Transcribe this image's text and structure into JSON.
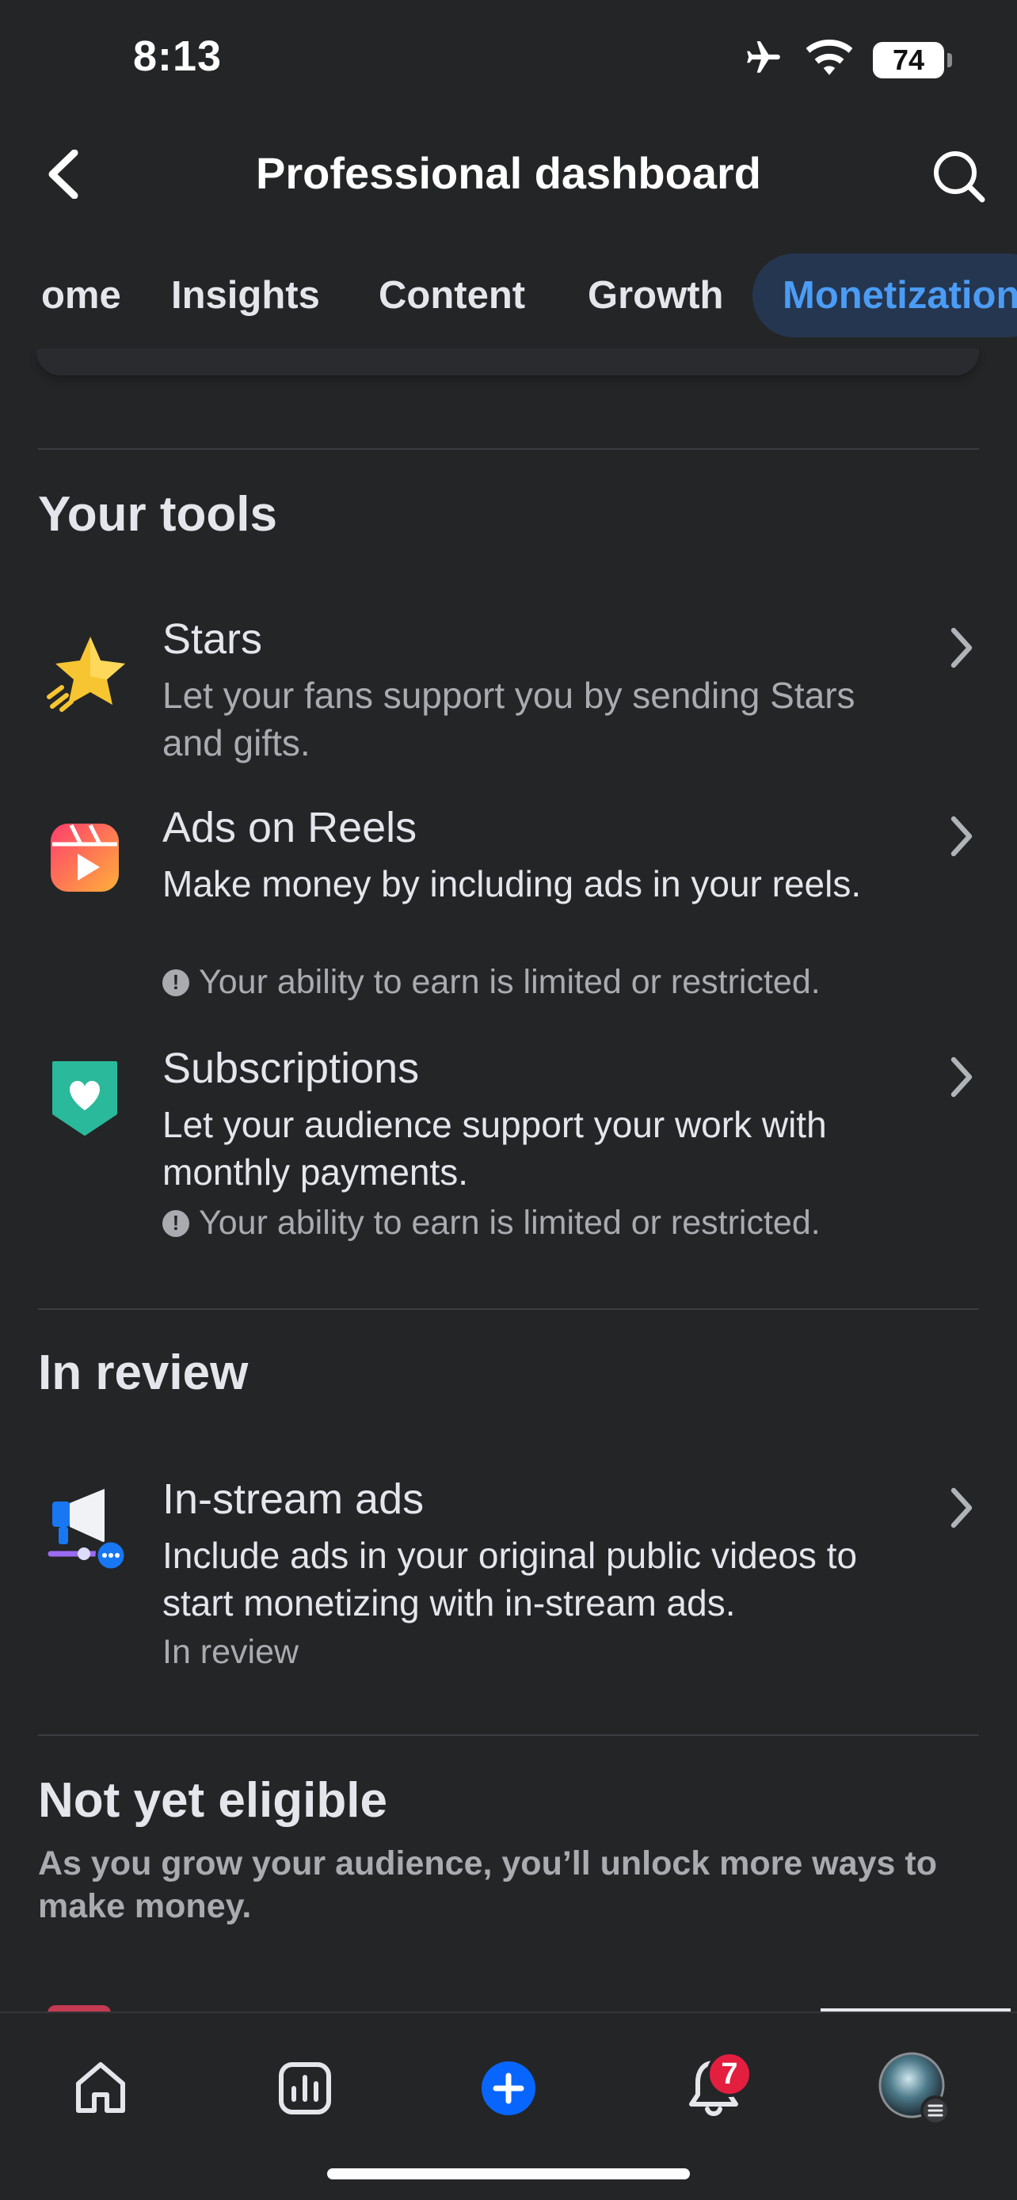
{
  "status_bar": {
    "time": "8:13",
    "battery": "74"
  },
  "header": {
    "title": "Professional dashboard"
  },
  "tabs": [
    {
      "label": "ome"
    },
    {
      "label": "Insights"
    },
    {
      "label": "Content"
    },
    {
      "label": "Growth"
    },
    {
      "label": "Monetization",
      "active": true
    }
  ],
  "your_tools": {
    "title": "Your tools",
    "items": [
      {
        "title": "Stars",
        "description": "Let your fans support you by sending Stars and gifts.",
        "icon": "star-icon"
      },
      {
        "title": "Ads on Reels",
        "description": "Make money by including ads in your reels.",
        "note": "Your ability to earn is limited or restricted.",
        "icon": "reels-icon"
      },
      {
        "title": "Subscriptions",
        "description": "Let your audience support your work with monthly payments.",
        "note": "Your ability to earn is limited or restricted.",
        "icon": "heart-badge-icon"
      }
    ]
  },
  "in_review": {
    "title": "In review",
    "items": [
      {
        "title": "In-stream ads",
        "description": "Include ads in your original public videos to start monetizing with in-stream ads.",
        "note": "In review",
        "icon": "megaphone-icon"
      }
    ]
  },
  "not_eligible": {
    "title": "Not yet eligible",
    "subtitle": "As you grow your audience, you’ll unlock more ways to make money."
  },
  "bottom_nav": {
    "items": [
      "home-icon",
      "insights-icon",
      "create-icon",
      "notifications-icon",
      "profile-avatar"
    ],
    "notification_count": "7"
  },
  "colors": {
    "accent": "#4b9cf5",
    "create": "#0866ff",
    "badge": "#e41e3f"
  }
}
